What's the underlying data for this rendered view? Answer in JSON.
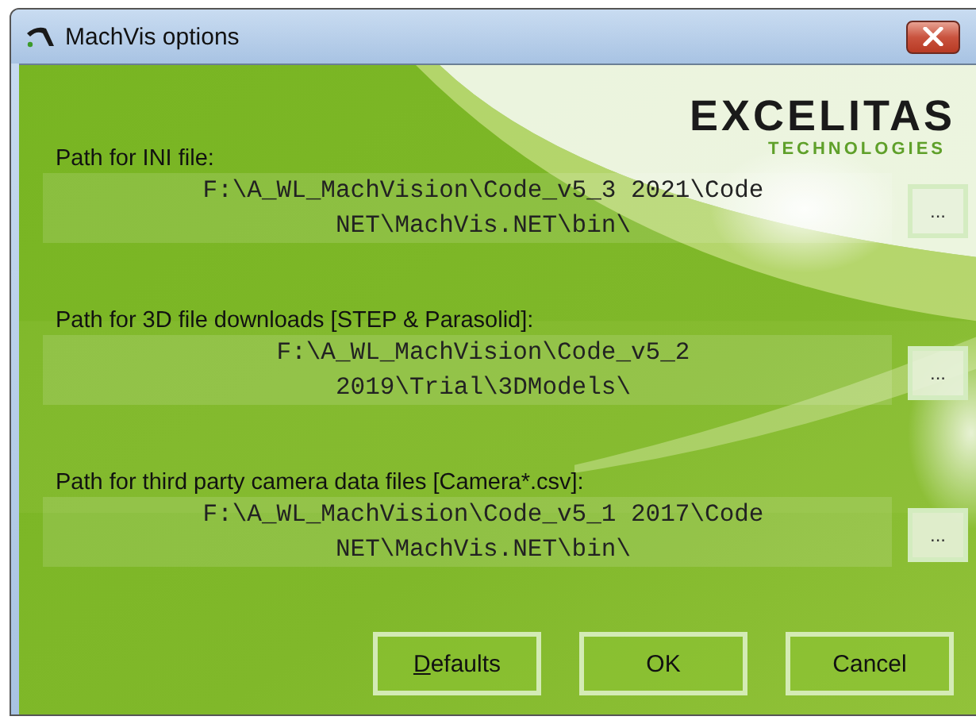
{
  "window": {
    "title": "MachVis options"
  },
  "logo": {
    "name": "EXCELITAS",
    "tagline": "TECHNOLOGIES"
  },
  "paths": [
    {
      "label": "Path for INI file:",
      "lines": [
        "F:\\A_WL_MachVision\\Code_v5_3 2021\\Code",
        "NET\\MachVis.NET\\bin\\"
      ],
      "browse": "..."
    },
    {
      "label": "Path for 3D file downloads [STEP & Parasolid]:",
      "lines": [
        "F:\\A_WL_MachVision\\Code_v5_2",
        "2019\\Trial\\3DModels\\"
      ],
      "browse": "..."
    },
    {
      "label": "Path for third party camera data files [Camera*.csv]:",
      "lines": [
        "F:\\A_WL_MachVision\\Code_v5_1 2017\\Code",
        "NET\\MachVis.NET\\bin\\"
      ],
      "browse": "..."
    }
  ],
  "buttons": [
    {
      "label": "Defaults",
      "underline_first": true
    },
    {
      "label": "OK",
      "underline_first": false
    },
    {
      "label": "Cancel",
      "underline_first": false
    }
  ]
}
